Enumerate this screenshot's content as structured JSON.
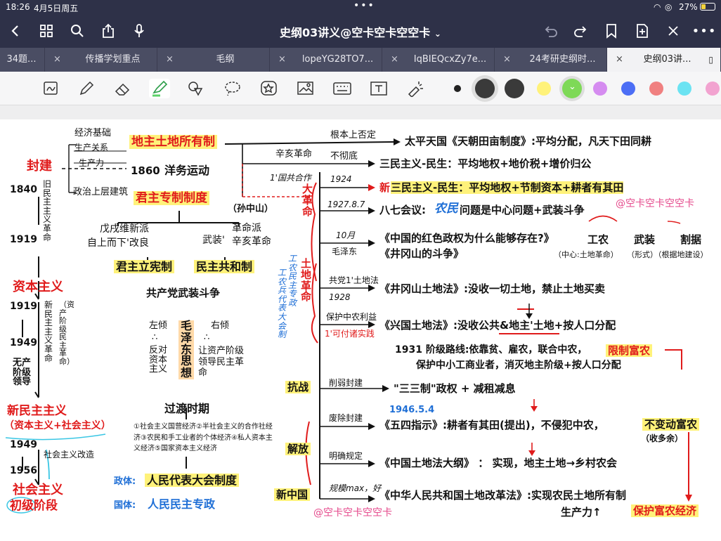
{
  "status": {
    "time": "18:26",
    "date": "4月5日周五",
    "battery": "27%"
  },
  "toolbar": {
    "title": "史纲03讲义@空卡空卡空空卡",
    "title_chevron": "⌄"
  },
  "tabs": [
    {
      "label": "34题..."
    },
    {
      "label": "传播学划重点"
    },
    {
      "label": "毛纲"
    },
    {
      "label": "lopeYG28TO7..."
    },
    {
      "label": "IqBIEQcxZy7e..."
    },
    {
      "label": "24考研史纲时..."
    },
    {
      "label": "史纲03讲..."
    }
  ],
  "tab_close": "×",
  "colors": {
    "black": "#222222",
    "darkgray": "#3a3a3a",
    "gray": "#4a4a4a",
    "yellow": "#fff27a",
    "green": "#7ed957",
    "purple": "#d58cf0",
    "blue": "#4c6ef5",
    "pink": "#f08080",
    "cyan": "#6be3f2"
  },
  "note": {
    "left": {
      "feudal": "封建",
      "y1840": "1840",
      "y1919": "1919",
      "old_dem": "旧民主主义革命",
      "capitalism": "资本主义",
      "y1919b": "1919",
      "y1949": "1949",
      "prole": "无产阶级领导",
      "new_dem": "新民主主义革命",
      "bourg": "（资产阶级民主革命）",
      "newdem_ism": "新民主主义",
      "cap_soc": "（资本主义+社会主义）",
      "y1949b": "1949",
      "y1956": "1956",
      "soc_transform": "社会主义改造",
      "socialism": "社会主义",
      "primary": "初级阶段"
    },
    "mid": {
      "econ_base": "经济基础",
      "prod_rel": "生产关系",
      "prod_force": "生产力",
      "super": "政治上层建筑",
      "landlord": "地主土地所有制",
      "y1860": "1860",
      "yangwu": "洋务运动",
      "monarchy": "君主专制制度",
      "sun": "（孙中山）",
      "reform": "戊戌维新派",
      "reform2": "自上而下'改良",
      "armed": "武装'",
      "revolt": "革命派",
      "revolt2": "辛亥革命",
      "const_mon": "君主立宪制",
      "republic": "民主共和制",
      "ccp_struggle": "共产党武装斗争",
      "left": "左倾",
      "left_dots": "∴",
      "left_anti": "反对资本主义",
      "mao": "毛泽东思想",
      "right": "右倾",
      "right_dots": "∴",
      "right_let": "让资产阶级领导民主革命",
      "transition": "过渡时期",
      "five": "①社会主义国营经济②半社会主义的合作社经济③农民和手工业者的个体经济④私人资本主义经济⑤国家资本主义经济",
      "zhengti": "政体:",
      "npc": "人民代表大会制度",
      "guoti": "国体:",
      "dictatorship": "人民民主专政"
    },
    "branch": {
      "root": "根本上否定",
      "xinhai": "辛亥革命",
      "not_thorough": "不彻底",
      "gc1": "1'国共合作",
      "y1924": "1924",
      "y1927": "1927.8.7",
      "oct": "10月",
      "maozedong": "毛泽东",
      "gc_land": "共党1'土地法",
      "y1928": "1928",
      "protect": "保护中农利益",
      "can_pay": "1'可付诸实践",
      "great_rev": "大革命",
      "land_rev": "土地革命",
      "soviet": "工农民主专政",
      "soviet2": "工农兵代表大会制",
      "war": "抗战",
      "liberation": "解放",
      "newchina": "新中国",
      "weaken": "削弱封建",
      "abolish": "废除封建",
      "clear": "明确规定",
      "scale": "规模max，好"
    },
    "right": {
      "taiping": "太平天国《天朝田亩制度》:平均分配，凡天下田同耕",
      "sanmin": "三民主义-民生：平均地权+地价税+增价归公",
      "xin": "新",
      "new_sanmin": "三民主义-民生：平均地权+节制资本+耕者有其田",
      "baqi": "八七会议:",
      "nongmin": "农民",
      "baqi2": "问题是中心问题+武装斗争",
      "red_q": "《中国的红色政权为什么能够存在?》",
      "jgs_struggle": "《井冈山的斗争》",
      "gongnong": "工农",
      "wuzhuang": "武装",
      "geju": "割据",
      "center": "（中心:土地革命）",
      "form": "（形式）（根据地建设）",
      "watermark": "@空卡空卡空空卡",
      "jgs_law": "《井冈山土地法》:没收一切土地，禁止土地买卖",
      "xg_law": "《兴国土地法》:没收公共&地主'土地+按人口分配",
      "y1931": "1931 阶级路线:依靠贫、雇农，联合中农，",
      "limit": "限制富农",
      "y1931b": "保护中小工商业者，消灭地主阶级+按人口分配",
      "sansan": "\"三三制\"政权 + 减租减息",
      "y1946": "1946.5.4",
      "wusi": "《五四指示》:耕者有其田(提出)，不侵犯中农，",
      "no_move": "不变动富农",
      "surplus": "（收多余）",
      "outline": "《中国土地法大纲》  ：  实现，地主土地→乡村农会",
      "reform_law": "《中华人民共和国土地改革法》:实现农民土地所有制",
      "prod": "生产力↑",
      "protect_rich": "保护富农经济",
      "watermark2": "@空卡空卡空空卡"
    }
  }
}
